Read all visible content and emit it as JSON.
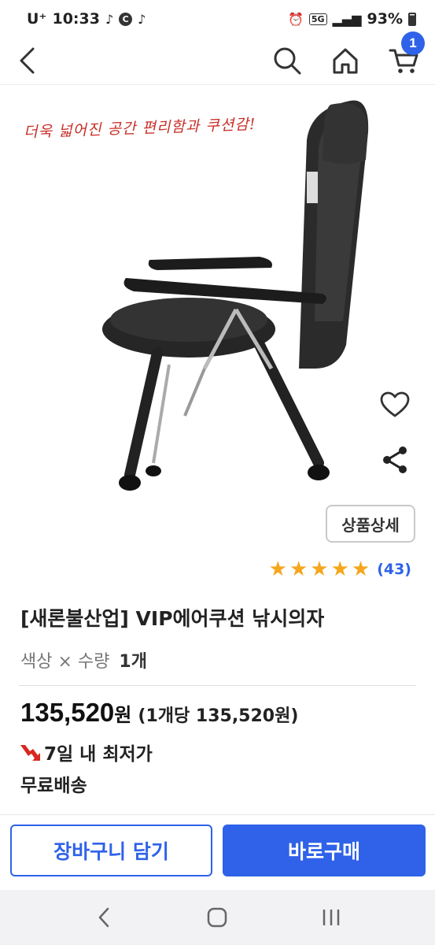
{
  "status_bar": {
    "carrier": "U⁺",
    "time": "10:33",
    "net_5g": "5G",
    "battery": "93%"
  },
  "header": {
    "cart_count": "1",
    "icons": [
      "back-icon",
      "search-icon",
      "home-icon",
      "cart-icon"
    ]
  },
  "product": {
    "promo_text": "더욱 넓어진 공간 편리함과 쿠션감!",
    "title": "[새론불산업] VIP에어쿠션 낚시의자",
    "detail_button": "상품상세",
    "rating_stars": 5,
    "review_count": "(43)"
  },
  "option": {
    "label": "색상 × 수량",
    "quantity": "1개"
  },
  "price": {
    "amount": "135,520",
    "currency": "원",
    "unit_price": "(1개당 135,520원)",
    "lowest_badge": "7일 내 최저가",
    "shipping": "무료배송"
  },
  "actions": {
    "add_to_cart": "장바구니 담기",
    "buy_now": "바로구매"
  },
  "colors": {
    "accent": "#2f62e8",
    "star": "#f5a61c",
    "promo": "#c8302a"
  }
}
